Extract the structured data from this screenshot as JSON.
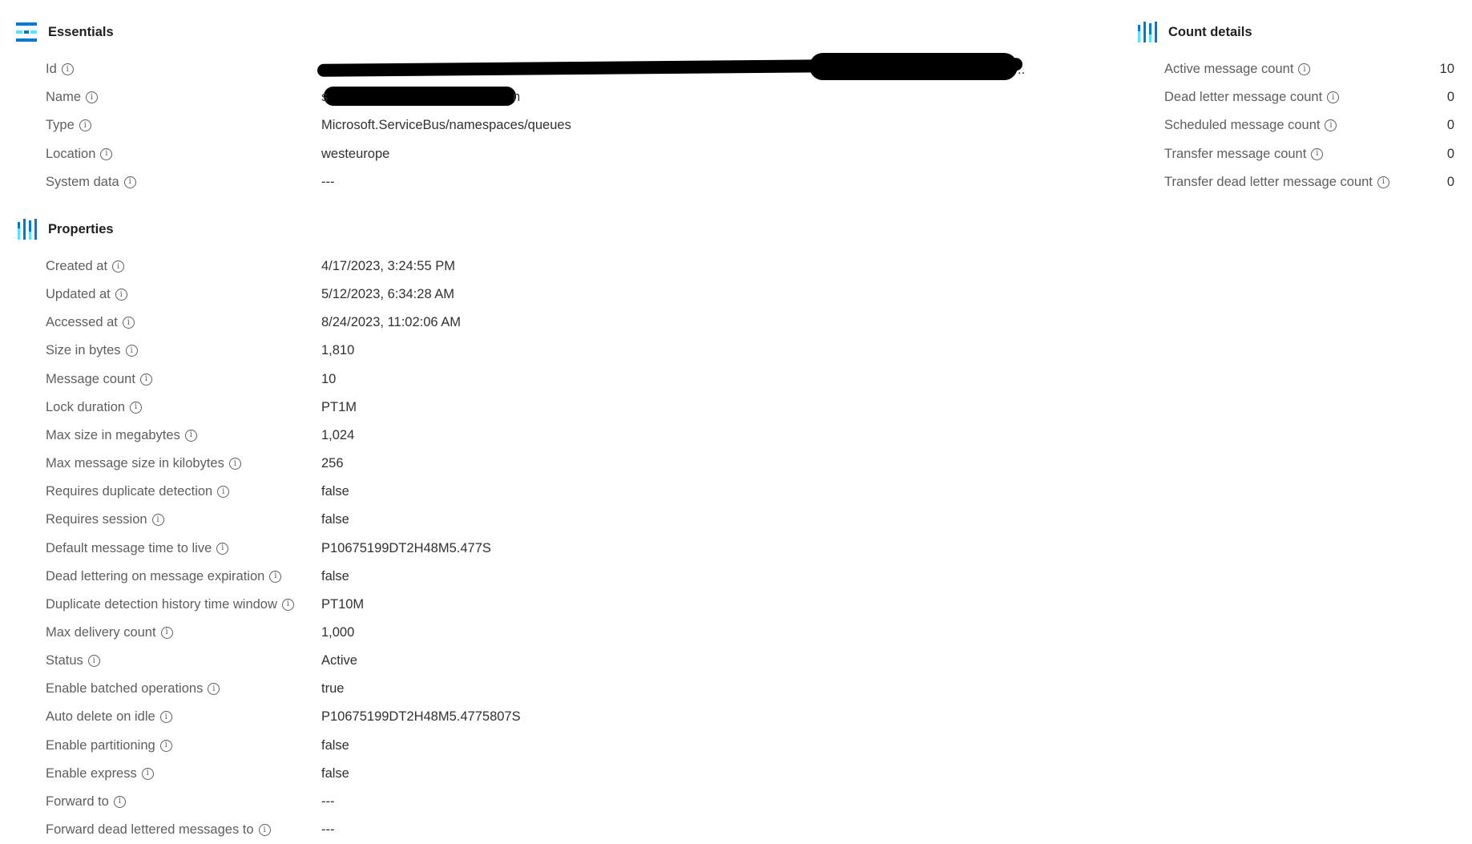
{
  "essentials": {
    "title": "Essentials",
    "icon": "essentials-icon",
    "rows": [
      {
        "label": "Id",
        "value": ""
      },
      {
        "label": "Name",
        "value": ""
      },
      {
        "label": "Type",
        "value": "Microsoft.ServiceBus/namespaces/queues"
      },
      {
        "label": "Location",
        "value": "westeurope"
      },
      {
        "label": "System data",
        "value": "---"
      }
    ],
    "redacted_id_tail": "..",
    "redacted_name_head": "s",
    "redacted_name_tail": "n"
  },
  "count_details": {
    "title": "Count details",
    "icon": "count-details-icon",
    "rows": [
      {
        "label": "Active message count",
        "value": "10"
      },
      {
        "label": "Dead letter message count",
        "value": "0"
      },
      {
        "label": "Scheduled message count",
        "value": "0"
      },
      {
        "label": "Transfer message count",
        "value": "0"
      },
      {
        "label": "Transfer dead letter message count",
        "value": "0"
      }
    ]
  },
  "properties": {
    "title": "Properties",
    "icon": "properties-icon",
    "rows": [
      {
        "label": "Created at",
        "value": "4/17/2023, 3:24:55 PM"
      },
      {
        "label": "Updated at",
        "value": "5/12/2023, 6:34:28 AM"
      },
      {
        "label": "Accessed at",
        "value": "8/24/2023, 11:02:06 AM"
      },
      {
        "label": "Size in bytes",
        "value": "1,810"
      },
      {
        "label": "Message count",
        "value": "10"
      },
      {
        "label": "Lock duration",
        "value": "PT1M"
      },
      {
        "label": "Max size in megabytes",
        "value": "1,024"
      },
      {
        "label": "Max message size in kilobytes",
        "value": "256"
      },
      {
        "label": "Requires duplicate detection",
        "value": "false"
      },
      {
        "label": "Requires session",
        "value": "false"
      },
      {
        "label": "Default message time to live",
        "value": "P10675199DT2H48M5.477S"
      },
      {
        "label": "Dead lettering on message expiration",
        "value": "false"
      },
      {
        "label": "Duplicate detection history time window",
        "value": "PT10M"
      },
      {
        "label": "Max delivery count",
        "value": "1,000"
      },
      {
        "label": "Status",
        "value": "Active"
      },
      {
        "label": "Enable batched operations",
        "value": "true"
      },
      {
        "label": "Auto delete on idle",
        "value": "P10675199DT2H48M5.4775807S"
      },
      {
        "label": "Enable partitioning",
        "value": "false"
      },
      {
        "label": "Enable express",
        "value": "false"
      },
      {
        "label": "Forward to",
        "value": "---"
      },
      {
        "label": "Forward dead lettered messages to",
        "value": "---"
      }
    ]
  },
  "info_glyph": "i",
  "colors": {
    "accent_blue": "#0078d4",
    "light_blue": "#50e6ff",
    "label_gray": "#605e5c",
    "text": "#323130"
  }
}
